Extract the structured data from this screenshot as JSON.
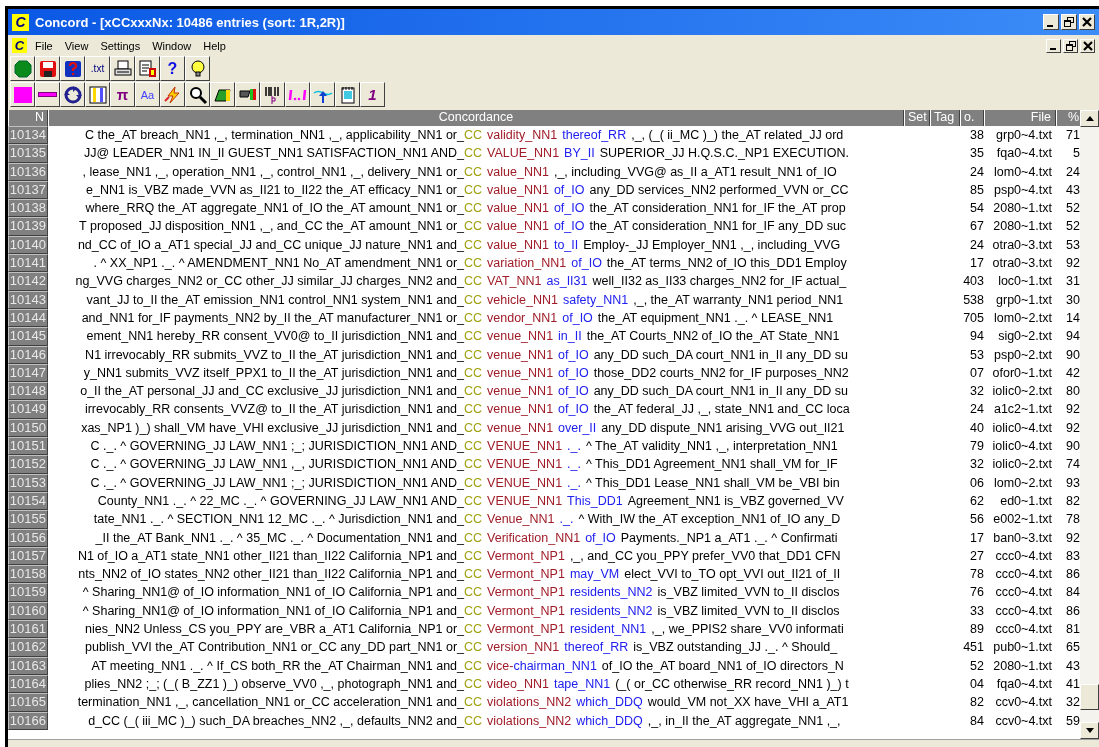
{
  "window": {
    "app_letter": "C",
    "title": "Concord - [xCCxxxNx: 10486 entries (sort: 1R,2R)]"
  },
  "menu": {
    "app_letter": "C",
    "items": [
      "File",
      "View",
      "Settings",
      "Window",
      "Help"
    ]
  },
  "toolbars": [
    [
      {
        "kind": "stop"
      },
      {
        "kind": "save"
      },
      {
        "kind": "help-book"
      },
      {
        "kind": "txt-label",
        "text": ".txt"
      },
      {
        "kind": "printer"
      },
      {
        "kind": "document"
      },
      {
        "kind": "help-glyph",
        "text": "?"
      },
      {
        "kind": "bulb"
      }
    ],
    [
      {
        "kind": "magenta-square"
      },
      {
        "kind": "line"
      },
      {
        "kind": "recycle"
      },
      {
        "kind": "columns"
      },
      {
        "kind": "pi-glyph",
        "text": "π"
      },
      {
        "kind": "font-glyph",
        "text": "Aa"
      },
      {
        "kind": "lightning"
      },
      {
        "kind": "magnifier"
      },
      {
        "kind": "flag"
      },
      {
        "kind": "flag-dark"
      },
      {
        "kind": "barcode"
      },
      {
        "kind": "span"
      },
      {
        "kind": "arrow-up"
      },
      {
        "kind": "notepad"
      },
      {
        "kind": "one-glyph",
        "text": "1"
      }
    ]
  ],
  "table": {
    "columns": [
      "N",
      "Concordance",
      "Set",
      "Tag",
      "o.",
      "File",
      "%"
    ],
    "rows": [
      {
        "n": "10134",
        "left": "C the_AT breach_NN1 ,_, termination_NN1 ,_, applicability_NN1 or_",
        "tag": "CC",
        "key": "validity_NN1",
        "coll": "thereof_RR",
        "right": ",_, (_( ii_MC )_) the_AT related_JJ ord",
        "number": "38",
        "file": "grp0~4.txt",
        "pct": "71"
      },
      {
        "n": "10135",
        "left": "JJ@ LEADER_NN1 IN_II GUEST_NN1 SATISFACTION_NN1 AND_",
        "tag": "CC",
        "key": "VALUE_NN1",
        "coll": "BY_II",
        "right": "SUPERIOR_JJ H.Q.S.C._NP1 EXECUTION.",
        "number": "35",
        "file": "fqa0~4.txt",
        "pct": "5"
      },
      {
        "n": "10136",
        "left": ", lease_NN1 ,_, operation_NN1 ,_, control_NN1 ,_, delivery_NN1 or_",
        "tag": "CC",
        "key": "value_NN1",
        "right": ",_, including_VVG@ as_II a_AT1 result_NN1 of_IO",
        "number": "24",
        "file": "lom0~4.txt",
        "pct": "24"
      },
      {
        "n": "10137",
        "left": "e_NN1 is_VBZ made_VVN as_II21 to_II22 the_AT efficacy_NN1 or_",
        "tag": "CC",
        "key": "value_NN1",
        "coll": "of_IO",
        "right": "any_DD services_NN2 performed_VVN or_CC",
        "number": "85",
        "file": "psp0~4.txt",
        "pct": "43"
      },
      {
        "n": "10138",
        "left": "where_RRQ the_AT aggregate_NN1 of_IO the_AT amount_NN1 or_",
        "tag": "CC",
        "key": "value_NN1",
        "coll": "of_IO",
        "right": "the_AT consideration_NN1 for_IF the_AT prop",
        "number": "54",
        "file": "2080~1.txt",
        "pct": "52"
      },
      {
        "n": "10139",
        "left": "T proposed_JJ disposition_NN1 ,_, and_CC the_AT amount_NN1 or_",
        "tag": "CC",
        "key": "value_NN1",
        "coll": "of_IO",
        "right": "the_AT consideration_NN1 for_IF any_DD suc",
        "number": "67",
        "file": "2080~1.txt",
        "pct": "52"
      },
      {
        "n": "10140",
        "left": "nd_CC of_IO a_AT1 special_JJ and_CC unique_JJ nature_NN1 and_",
        "tag": "CC",
        "key": "value_NN1",
        "coll": "to_II",
        "right": "Employ-_JJ Employer_NN1 ,_, including_VVG",
        "number": "24",
        "file": "otra0~3.txt",
        "pct": "53"
      },
      {
        "n": "10141",
        "left": ". ^ XX_NP1 ._. ^ AMENDMENT_NN1 No_AT amendment_NN1 or_",
        "tag": "CC",
        "key": "variation_NN1",
        "coll": "of_IO",
        "right": "the_AT terms_NN2 of_IO this_DD1 Employ",
        "number": "17",
        "file": "otra0~3.txt",
        "pct": "92"
      },
      {
        "n": "10142",
        "left": "ng_VVG charges_NN2 or_CC other_JJ similar_JJ charges_NN2 and_",
        "tag": "CC",
        "key": "VAT_NN1",
        "coll": "as_II31",
        "right": "well_II32 as_II33 charges_NN2 for_IF actual_",
        "number": "403",
        "file": "loc0~1.txt",
        "pct": "31"
      },
      {
        "n": "10143",
        "left": "vant_JJ to_II the_AT emission_NN1 control_NN1 system_NN1 and_",
        "tag": "CC",
        "key": "vehicle_NN1",
        "coll": "safety_NN1",
        "right": ",_, the_AT warranty_NN1 period_NN1",
        "number": "538",
        "file": "grp0~1.txt",
        "pct": "30"
      },
      {
        "n": "10144",
        "left": "and_NN1 for_IF payments_NN2 by_II the_AT manufacturer_NN1 or_",
        "tag": "CC",
        "key": "vendor_NN1",
        "coll": "of_IO",
        "right": "the_AT equipment_NN1 ._. ^ LEASE_NN1",
        "number": "705",
        "file": "lom0~2.txt",
        "pct": "14"
      },
      {
        "n": "10145",
        "left": "ement_NN1 hereby_RR consent_VV0@ to_II jurisdiction_NN1 and_",
        "tag": "CC",
        "key": "venue_NN1",
        "coll": "in_II",
        "right": "the_AT Courts_NN2 of_IO the_AT State_NN1",
        "number": "94",
        "file": "sig0~2.txt",
        "pct": "94"
      },
      {
        "n": "10146",
        "left": "N1 irrevocably_RR submits_VVZ to_II the_AT jurisdiction_NN1 and_",
        "tag": "CC",
        "key": "venue_NN1",
        "coll": "of_IO",
        "right": "any_DD such_DA court_NN1 in_II any_DD su",
        "number": "53",
        "file": "psp0~2.txt",
        "pct": "90"
      },
      {
        "n": "10147",
        "left": "y_NN1 submits_VVZ itself_PPX1 to_II the_AT jurisdiction_NN1 and_",
        "tag": "CC",
        "key": "venue_NN1",
        "coll": "of_IO",
        "right": "those_DD2 courts_NN2 for_IF purposes_NN2",
        "number": "07",
        "file": "ofor0~1.txt",
        "pct": "42"
      },
      {
        "n": "10148",
        "left": "o_II the_AT personal_JJ and_CC exclusive_JJ jurisdiction_NN1 and_",
        "tag": "CC",
        "key": "venue_NN1",
        "coll": "of_IO",
        "right": "any_DD such_DA court_NN1 in_II any_DD su",
        "number": "32",
        "file": "iolic0~2.txt",
        "pct": "80"
      },
      {
        "n": "10149",
        "left": "irrevocably_RR consents_VVZ@ to_II the_AT jurisdiction_NN1 and_",
        "tag": "CC",
        "key": "venue_NN1",
        "coll": "of_IO",
        "right": "the_AT federal_JJ ,_, state_NN1 and_CC loca",
        "number": "24",
        "file": "a1c2~1.txt",
        "pct": "92"
      },
      {
        "n": "10150",
        "left": "xas_NP1 )_) shall_VM have_VHI exclusive_JJ jurisdiction_NN1 and_",
        "tag": "CC",
        "key": "venue_NN1",
        "coll": "over_II",
        "right": "any_DD dispute_NN1 arising_VVG out_II21",
        "number": "40",
        "file": "iolic0~4.txt",
        "pct": "92"
      },
      {
        "n": "10151",
        "left": "C ._. ^ GOVERNING_JJ LAW_NN1 ;_; JURISDICTION_NN1 AND_",
        "tag": "CC",
        "key": "VENUE_NN1",
        "coll": "._.",
        "right": "^ The_AT validity_NN1 ,_, interpretation_NN1",
        "number": "79",
        "file": "iolic0~4.txt",
        "pct": "90"
      },
      {
        "n": "10152",
        "left": "C ._. ^ GOVERNING_JJ LAW_NN1 ,_, JURISDICTION_NN1 AND_",
        "tag": "CC",
        "key": "VENUE_NN1",
        "coll": "._.",
        "right": "^ This_DD1 Agreement_NN1 shall_VM for_IF",
        "number": "32",
        "file": "iolic0~2.txt",
        "pct": "74"
      },
      {
        "n": "10153",
        "left": "C ._. ^ GOVERNING_JJ LAW_NN1 ;_; JURISDICTION_NN1 AND_",
        "tag": "CC",
        "key": "VENUE_NN1",
        "coll": "._.",
        "right": "^ This_DD1 Lease_NN1 shall_VM be_VBI bin",
        "number": "06",
        "file": "lom0~2.txt",
        "pct": "93"
      },
      {
        "n": "10154",
        "left": "County_NN1 ._. ^ 22_MC ._. ^ GOVERNING_JJ LAW_NN1 AND_",
        "tag": "CC",
        "key": "VENUE_NN1",
        "coll": "This_DD1",
        "right": "Agreement_NN1 is_VBZ governed_VV",
        "number": "62",
        "file": "ed0~1.txt",
        "pct": "82"
      },
      {
        "n": "10155",
        "left": "tate_NN1 ._. ^ SECTION_NN1 12_MC ._. ^ Jurisdiction_NN1 and_",
        "tag": "CC",
        "key": "Venue_NN1",
        "coll": "._.",
        "right": "^ With_IW the_AT exception_NN1 of_IO any_D",
        "number": "56",
        "file": "e002~1.txt",
        "pct": "78"
      },
      {
        "n": "10156",
        "left": "_II the_AT Bank_NN1 ._. ^ 35_MC ._. ^ Documentation_NN1 and_",
        "tag": "CC",
        "key": "Verification_NN1",
        "coll": "of_IO",
        "right": "Payments._NP1 a_AT1 ._. ^ Confirmati",
        "number": "17",
        "file": "ban0~3.txt",
        "pct": "92"
      },
      {
        "n": "10157",
        "left": "N1 of_IO a_AT1 state_NN1 other_II21 than_II22 California_NP1 and_",
        "tag": "CC",
        "key": "Vermont_NP1",
        "right": ",_, and_CC you_PPY prefer_VV0 that_DD1 CFN",
        "number": "27",
        "file": "ccc0~4.txt",
        "pct": "83"
      },
      {
        "n": "10158",
        "left": "nts_NN2 of_IO states_NN2 other_II21 than_II22 California_NP1 and_",
        "tag": "CC",
        "key": "Vermont_NP1",
        "coll": "may_VM",
        "right": "elect_VVI to_TO opt_VVI out_II21 of_II",
        "number": "78",
        "file": "ccc0~4.txt",
        "pct": "86"
      },
      {
        "n": "10159",
        "left": "^ Sharing_NN1@ of_IO information_NN1 of_IO California_NP1 and_",
        "tag": "CC",
        "key": "Vermont_NP1",
        "coll": "residents_NN2",
        "right": "is_VBZ limited_VVN to_II disclos",
        "number": "76",
        "file": "ccc0~4.txt",
        "pct": "84"
      },
      {
        "n": "10160",
        "left": "^ Sharing_NN1@ of_IO information_NN1 of_IO California_NP1 and_",
        "tag": "CC",
        "key": "Vermont_NP1",
        "coll": "residents_NN2",
        "right": "is_VBZ limited_VVN to_II disclos",
        "number": "33",
        "file": "ccc0~4.txt",
        "pct": "86"
      },
      {
        "n": "10161",
        "left": "nies_NN2 Unless_CS you_PPY are_VBR a_AT1 California_NP1 or_",
        "tag": "CC",
        "key": "Vermont_NP1",
        "coll": "resident_NN1",
        "right": ",_, we_PPIS2 share_VV0 informati",
        "number": "89",
        "file": "ccc0~4.txt",
        "pct": "81"
      },
      {
        "n": "10162",
        "left": "publish_VVI the_AT Contribution_NN1 or_CC any_DD part_NN1 or_",
        "tag": "CC",
        "key": "version_NN1",
        "coll": "thereof_RR",
        "right": "is_VBZ outstanding_JJ ._. ^ Should_",
        "number": "451",
        "file": "pub0~1.txt",
        "pct": "65"
      },
      {
        "n": "10163",
        "left": "AT meeting_NN1 ._. ^ If_CS both_RR the_AT Chairman_NN1 and_",
        "tag": "CC",
        "key": "vice-",
        "coll": "chairman_NN1",
        "coll_attached": true,
        "right": "of_IO the_AT board_NN1 of_IO directors_N",
        "number": "52",
        "file": "2080~1.txt",
        "pct": "43"
      },
      {
        "n": "10164",
        "left": "plies_NN2 ;_; (_( B_ZZ1 )_) observe_VV0 ,_, photograph_NN1 and_",
        "tag": "CC",
        "key": "video_NN1",
        "coll": "tape_NN1",
        "right": "(_( or_CC otherwise_RR record_NN1 )_) t",
        "number": "04",
        "file": "fqa0~4.txt",
        "pct": "41"
      },
      {
        "n": "10165",
        "left": "termination_NN1 ,_, cancellation_NN1 or_CC acceleration_NN1 and_",
        "tag": "CC",
        "key": "violations_NN2",
        "coll": "which_DDQ",
        "right": "would_VM not_XX have_VHI a_AT1",
        "number": "82",
        "file": "ccv0~4.txt",
        "pct": "32"
      },
      {
        "n": "10166",
        "left": "d_CC (_( iii_MC )_) such_DA breaches_NN2 ,_, defaults_NN2 and_",
        "tag": "CC",
        "key": "violations_NN2",
        "coll": "which_DDQ",
        "right": ",_, in_II the_AT aggregate_NN1 ,_,",
        "number": "84",
        "file": "ccv0~4.txt",
        "pct": "59"
      }
    ]
  }
}
